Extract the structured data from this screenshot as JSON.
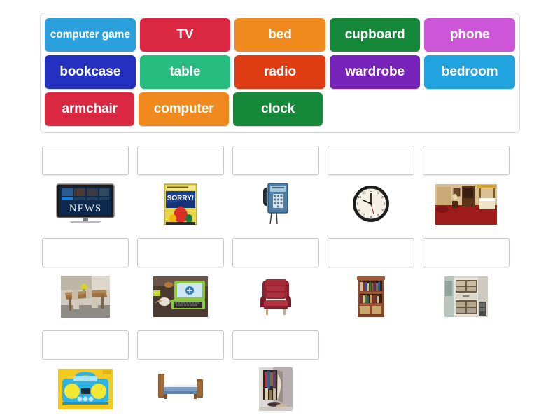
{
  "activity": {
    "type": "match-up-drag-and-drop",
    "title": "Match up"
  },
  "tile_bank": {
    "name": "word-tile-bank",
    "rows": [
      [
        {
          "label": "computer game",
          "color": "#2BA0DC",
          "two_line": true,
          "name": "tile-computer-game"
        },
        {
          "label": "TV",
          "color": "#DB2842",
          "two_line": false,
          "name": "tile-tv"
        },
        {
          "label": "bed",
          "color": "#F18A1E",
          "two_line": false,
          "name": "tile-bed"
        },
        {
          "label": "cupboard",
          "color": "#15883A",
          "two_line": false,
          "name": "tile-cupboard"
        },
        {
          "label": "phone",
          "color": "#CC55D8",
          "two_line": false,
          "name": "tile-phone"
        }
      ],
      [
        {
          "label": "bookcase",
          "color": "#2431C0",
          "two_line": false,
          "name": "tile-bookcase"
        },
        {
          "label": "table",
          "color": "#27BD81",
          "two_line": false,
          "name": "tile-table"
        },
        {
          "label": "radio",
          "color": "#E03C14",
          "two_line": false,
          "name": "tile-radio"
        },
        {
          "label": "wardrobe",
          "color": "#7722B8",
          "two_line": false,
          "name": "tile-wardrobe"
        },
        {
          "label": "bedroom",
          "color": "#20A3DE",
          "two_line": false,
          "name": "tile-bedroom"
        }
      ],
      [
        {
          "label": "armchair",
          "color": "#DB2842",
          "two_line": false,
          "name": "tile-armchair"
        },
        {
          "label": "computer",
          "color": "#F18A1E",
          "two_line": false,
          "name": "tile-computer"
        },
        {
          "label": "clock",
          "color": "#15883A",
          "two_line": false,
          "name": "tile-clock"
        }
      ]
    ]
  },
  "answer_grid": {
    "name": "answer-grid",
    "dropzone_value": "",
    "rows": [
      [
        {
          "picture": "television-news",
          "alt": "flatscreen television showing news"
        },
        {
          "picture": "board-game-box",
          "alt": "Sorry board game box"
        },
        {
          "picture": "payphone",
          "alt": "blue wall payphone"
        },
        {
          "picture": "wall-clock",
          "alt": "round analogue wall clock"
        },
        {
          "picture": "bedroom-interior",
          "alt": "bedroom with red carpet and four poster bed"
        }
      ],
      [
        {
          "picture": "dining-table",
          "alt": "wooden dining table with chairs"
        },
        {
          "picture": "green-laptop",
          "alt": "green laptop computer with mouse"
        },
        {
          "picture": "red-armchair",
          "alt": "red upholstered armchair"
        },
        {
          "picture": "wooden-bookcase",
          "alt": "tall wooden bookcase with books"
        },
        {
          "picture": "kitchen-cupboard",
          "alt": "white kitchen cupboard with shelves"
        }
      ],
      [
        {
          "picture": "blue-radio",
          "alt": "blue portable radio on yellow background"
        },
        {
          "picture": "wooden-bed",
          "alt": "wooden bed with blue bedding"
        },
        {
          "picture": "open-wardrobe",
          "alt": "open wardrobe with clothes"
        }
      ]
    ]
  },
  "colors": {
    "page_background": "#ffffff",
    "bank_border": "#d8d8d8",
    "dropzone_border": "#c9c9c9",
    "tile_text": "#ffffff"
  }
}
